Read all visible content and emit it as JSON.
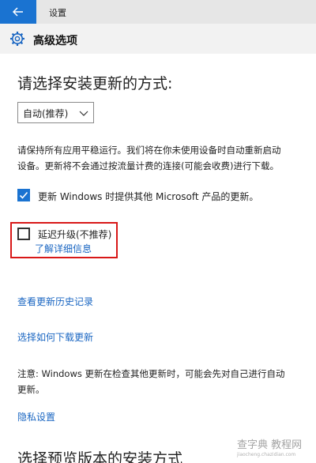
{
  "window": {
    "title": "设置"
  },
  "header": {
    "title": "高级选项"
  },
  "main": {
    "section_title": "请选择安装更新的方式:",
    "install_mode": {
      "selected": "自动(推荐)"
    },
    "install_desc_line1": "请保持所有应用平稳运行。我们将在你未使用设备时自动重新启动",
    "install_desc_line2": "设备。更新将不会通过按流量计费的连接(可能会收费)进行下载。",
    "option_other_products": {
      "label": "更新 Windows 时提供其他 Microsoft 产品的更新。",
      "checked": true
    },
    "option_defer": {
      "label": "延迟升级(不推荐)",
      "checked": false,
      "learn_more": "了解详细信息"
    },
    "link_history": "查看更新历史记录",
    "link_delivery": "选择如何下载更新",
    "note_line1": "注意: Windows 更新在检查其他更新时，可能会先对自己进行自动",
    "note_line2": "更新。",
    "link_privacy": "隐私设置",
    "section2_title": "选择预览版本的安装方式"
  },
  "watermark": {
    "brand": "查字典 教程网",
    "sub": "jiaocheng.chazidian.com"
  },
  "colors": {
    "accent": "#1a73d1",
    "link": "#1a66c2",
    "highlight_box": "#d81818"
  },
  "icons": {
    "back": "back-arrow-icon",
    "settings": "gear-icon",
    "dropdown": "chevron-down-icon",
    "check": "checkmark-icon"
  }
}
